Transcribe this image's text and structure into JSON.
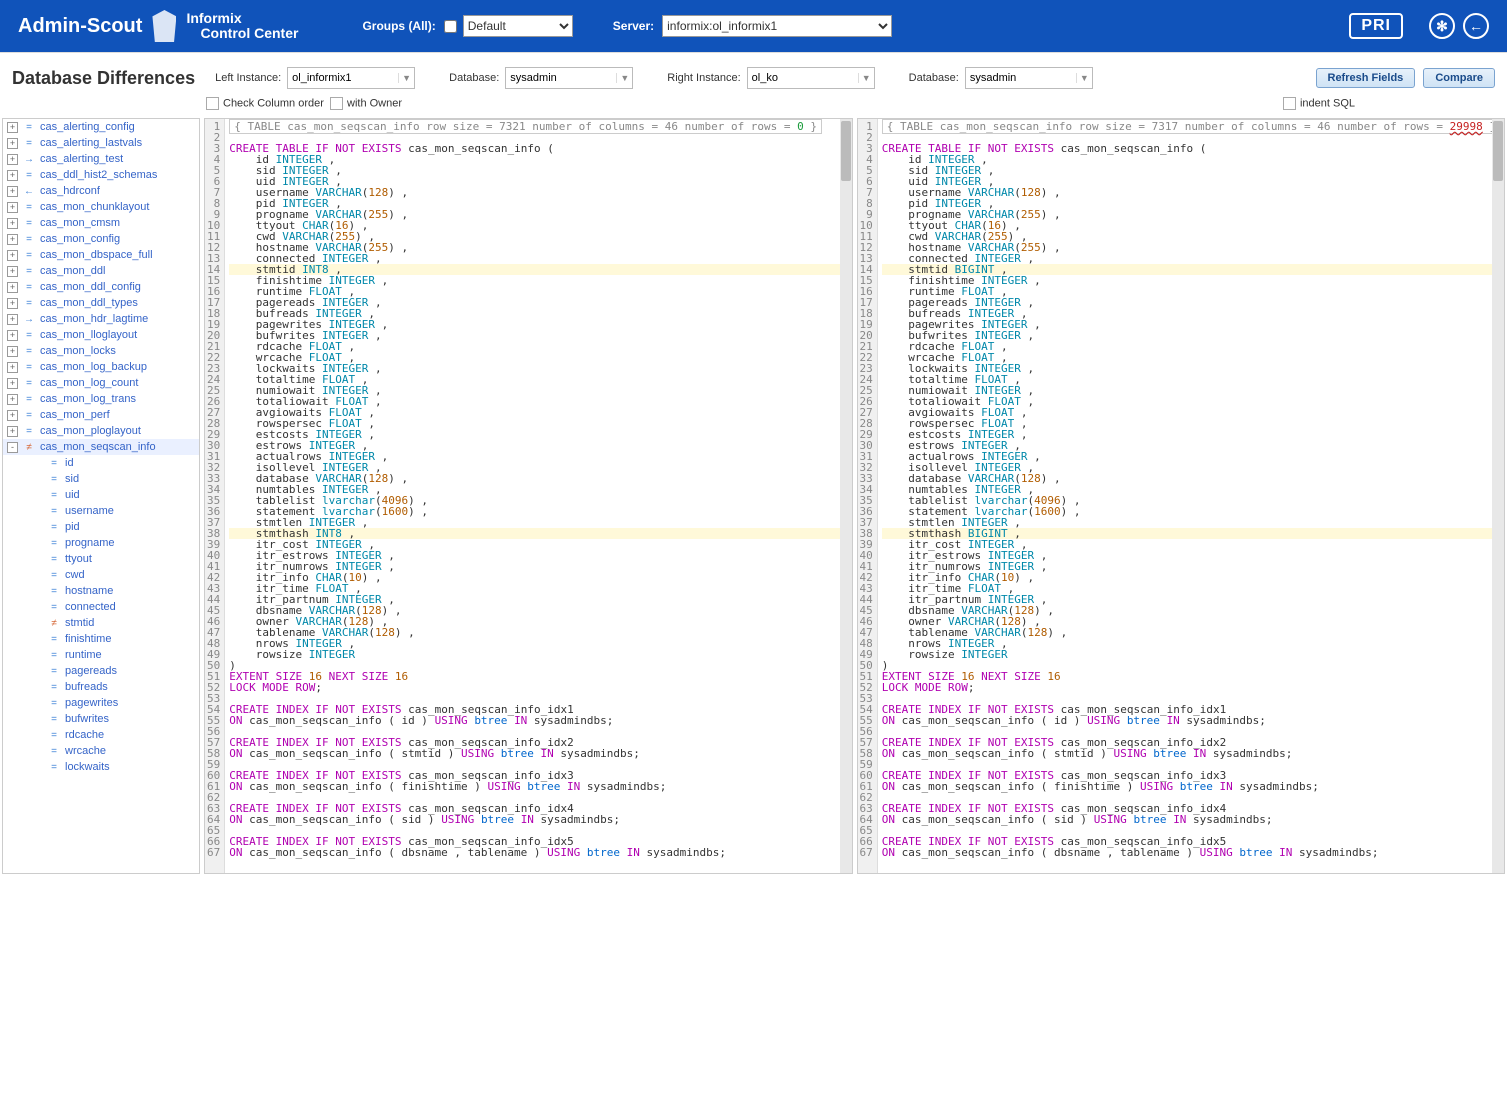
{
  "topbar": {
    "brand": "Admin-Scout",
    "subbrand1": "Informix",
    "subbrand2": "Control Center",
    "groups_label": "Groups (All):",
    "groups_select": "Default",
    "server_label": "Server:",
    "server_select": "informix:ol_informix1",
    "pri_badge": "PRI"
  },
  "toolbar": {
    "title": "Database Differences",
    "left_instance_label": "Left Instance:",
    "left_instance_val": "ol_informix1",
    "left_db_label": "Database:",
    "left_db_val": "sysadmin",
    "right_instance_label": "Right Instance:",
    "right_instance_val": "ol_ko",
    "right_db_label": "Database:",
    "right_db_val": "sysadmin",
    "refresh_btn": "Refresh Fields",
    "compare_btn": "Compare",
    "check_col_order": "Check Column order",
    "with_owner": "with Owner",
    "indent_sql": "indent SQL"
  },
  "tree": {
    "items": [
      {
        "exp": "+",
        "icon": "=",
        "label": "cas_alerting_config",
        "cut": true
      },
      {
        "exp": "+",
        "icon": "=",
        "label": "cas_alerting_lastvals"
      },
      {
        "exp": "+",
        "icon": "→",
        "label": "cas_alerting_test"
      },
      {
        "exp": "+",
        "icon": "=",
        "label": "cas_ddl_hist2_schemas"
      },
      {
        "exp": "+",
        "icon": "←",
        "label": "cas_hdrconf"
      },
      {
        "exp": "+",
        "icon": "=",
        "label": "cas_mon_chunklayout"
      },
      {
        "exp": "+",
        "icon": "=",
        "label": "cas_mon_cmsm"
      },
      {
        "exp": "+",
        "icon": "=",
        "label": "cas_mon_config"
      },
      {
        "exp": "+",
        "icon": "=",
        "label": "cas_mon_dbspace_full"
      },
      {
        "exp": "+",
        "icon": "=",
        "label": "cas_mon_ddl"
      },
      {
        "exp": "+",
        "icon": "=",
        "label": "cas_mon_ddl_config"
      },
      {
        "exp": "+",
        "icon": "=",
        "label": "cas_mon_ddl_types"
      },
      {
        "exp": "+",
        "icon": "→",
        "label": "cas_mon_hdr_lagtime"
      },
      {
        "exp": "+",
        "icon": "=",
        "label": "cas_mon_lloglayout"
      },
      {
        "exp": "+",
        "icon": "=",
        "label": "cas_mon_locks"
      },
      {
        "exp": "+",
        "icon": "=",
        "label": "cas_mon_log_backup"
      },
      {
        "exp": "+",
        "icon": "=",
        "label": "cas_mon_log_count"
      },
      {
        "exp": "+",
        "icon": "=",
        "label": "cas_mon_log_trans"
      },
      {
        "exp": "+",
        "icon": "=",
        "label": "cas_mon_perf"
      },
      {
        "exp": "+",
        "icon": "=",
        "label": "cas_mon_ploglayout"
      },
      {
        "exp": "-",
        "icon": "≠",
        "label": "cas_mon_seqscan_info",
        "selected": true
      }
    ],
    "children": [
      {
        "icon": "=",
        "label": "id"
      },
      {
        "icon": "=",
        "label": "sid"
      },
      {
        "icon": "=",
        "label": "uid"
      },
      {
        "icon": "=",
        "label": "username"
      },
      {
        "icon": "=",
        "label": "pid"
      },
      {
        "icon": "=",
        "label": "progname"
      },
      {
        "icon": "=",
        "label": "ttyout"
      },
      {
        "icon": "=",
        "label": "cwd"
      },
      {
        "icon": "=",
        "label": "hostname"
      },
      {
        "icon": "=",
        "label": "connected"
      },
      {
        "icon": "≠",
        "label": "stmtid"
      },
      {
        "icon": "=",
        "label": "finishtime"
      },
      {
        "icon": "=",
        "label": "runtime"
      },
      {
        "icon": "=",
        "label": "pagereads"
      },
      {
        "icon": "=",
        "label": "bufreads"
      },
      {
        "icon": "=",
        "label": "pagewrites"
      },
      {
        "icon": "=",
        "label": "bufwrites"
      },
      {
        "icon": "=",
        "label": "rdcache"
      },
      {
        "icon": "=",
        "label": "wrcache"
      },
      {
        "icon": "=",
        "label": "lockwaits"
      }
    ]
  },
  "code_left": {
    "meta": {
      "table": "cas_mon_seqscan_info",
      "row_size": "7321",
      "cols": "46",
      "rows": "0",
      "rows_diff": false
    },
    "diff_type_14": "INT8",
    "diff_type_38": "INT8"
  },
  "code_right": {
    "meta": {
      "table": "cas_mon_seqscan_info",
      "row_size": "7317",
      "cols": "46",
      "rows": "29998",
      "rows_diff": true
    },
    "diff_type_14": "BIGINT",
    "diff_type_38": "BIGINT"
  },
  "sql": {
    "table": "cas_mon_seqscan_info",
    "cols": [
      {
        "n": "id",
        "t": "INTEGER"
      },
      {
        "n": "sid",
        "t": "INTEGER"
      },
      {
        "n": "uid",
        "t": "INTEGER"
      },
      {
        "n": "username",
        "t": "VARCHAR",
        "a": "128"
      },
      {
        "n": "pid",
        "t": "INTEGER"
      },
      {
        "n": "progname",
        "t": "VARCHAR",
        "a": "255"
      },
      {
        "n": "ttyout",
        "t": "CHAR",
        "a": "16"
      },
      {
        "n": "cwd",
        "t": "VARCHAR",
        "a": "255"
      },
      {
        "n": "hostname",
        "t": "VARCHAR",
        "a": "255"
      },
      {
        "n": "connected",
        "t": "INTEGER"
      },
      {
        "n": "stmtid",
        "t": "__DIFF14__",
        "hl": true
      },
      {
        "n": "finishtime",
        "t": "INTEGER"
      },
      {
        "n": "runtime",
        "t": "FLOAT"
      },
      {
        "n": "pagereads",
        "t": "INTEGER"
      },
      {
        "n": "bufreads",
        "t": "INTEGER"
      },
      {
        "n": "pagewrites",
        "t": "INTEGER"
      },
      {
        "n": "bufwrites",
        "t": "INTEGER"
      },
      {
        "n": "rdcache",
        "t": "FLOAT"
      },
      {
        "n": "wrcache",
        "t": "FLOAT"
      },
      {
        "n": "lockwaits",
        "t": "INTEGER"
      },
      {
        "n": "totaltime",
        "t": "FLOAT"
      },
      {
        "n": "numiowait",
        "t": "INTEGER"
      },
      {
        "n": "totaliowait",
        "t": "FLOAT"
      },
      {
        "n": "avgiowaits",
        "t": "FLOAT"
      },
      {
        "n": "rowspersec",
        "t": "FLOAT"
      },
      {
        "n": "estcosts",
        "t": "INTEGER"
      },
      {
        "n": "estrows",
        "t": "INTEGER"
      },
      {
        "n": "actualrows",
        "t": "INTEGER"
      },
      {
        "n": "isollevel",
        "t": "INTEGER"
      },
      {
        "n": "database",
        "t": "VARCHAR",
        "a": "128"
      },
      {
        "n": "numtables",
        "t": "INTEGER"
      },
      {
        "n": "tablelist",
        "t": "lvarchar",
        "a": "4096"
      },
      {
        "n": "statement",
        "t": "lvarchar",
        "a": "1600"
      },
      {
        "n": "stmtlen",
        "t": "INTEGER"
      },
      {
        "n": "stmthash",
        "t": "__DIFF38__",
        "hl": true
      },
      {
        "n": "itr_cost",
        "t": "INTEGER"
      },
      {
        "n": "itr_estrows",
        "t": "INTEGER"
      },
      {
        "n": "itr_numrows",
        "t": "INTEGER"
      },
      {
        "n": "itr_info",
        "t": "CHAR",
        "a": "10"
      },
      {
        "n": "itr_time",
        "t": "FLOAT"
      },
      {
        "n": "itr_partnum",
        "t": "INTEGER"
      },
      {
        "n": "dbsname",
        "t": "VARCHAR",
        "a": "128"
      },
      {
        "n": "owner",
        "t": "VARCHAR",
        "a": "128"
      },
      {
        "n": "tablename",
        "t": "VARCHAR",
        "a": "128"
      },
      {
        "n": "nrows",
        "t": "INTEGER"
      },
      {
        "n": "rowsize",
        "t": "INTEGER",
        "last": true
      }
    ],
    "tail": [
      ")",
      "EXTENT SIZE 16 NEXT SIZE 16",
      "LOCK MODE ROW;",
      "",
      "CREATE INDEX IF NOT EXISTS cas_mon_seqscan_info_idx1",
      "ON cas_mon_seqscan_info ( id ) USING btree IN sysadmindbs;",
      "",
      "CREATE INDEX IF NOT EXISTS cas_mon_seqscan_info_idx2",
      "ON cas_mon_seqscan_info ( stmtid ) USING btree IN sysadmindbs;",
      "",
      "CREATE INDEX IF NOT EXISTS cas_mon_seqscan_info_idx3",
      "ON cas_mon_seqscan_info ( finishtime ) USING btree IN sysadmindbs;",
      "",
      "CREATE INDEX IF NOT EXISTS cas_mon_seqscan_info_idx4",
      "ON cas_mon_seqscan_info ( sid ) USING btree IN sysadmindbs;",
      "",
      "CREATE INDEX IF NOT EXISTS cas_mon_seqscan_info_idx5",
      "ON cas_mon_seqscan_info ( dbsname , tablename ) USING btree IN sysadmindbs;"
    ]
  }
}
